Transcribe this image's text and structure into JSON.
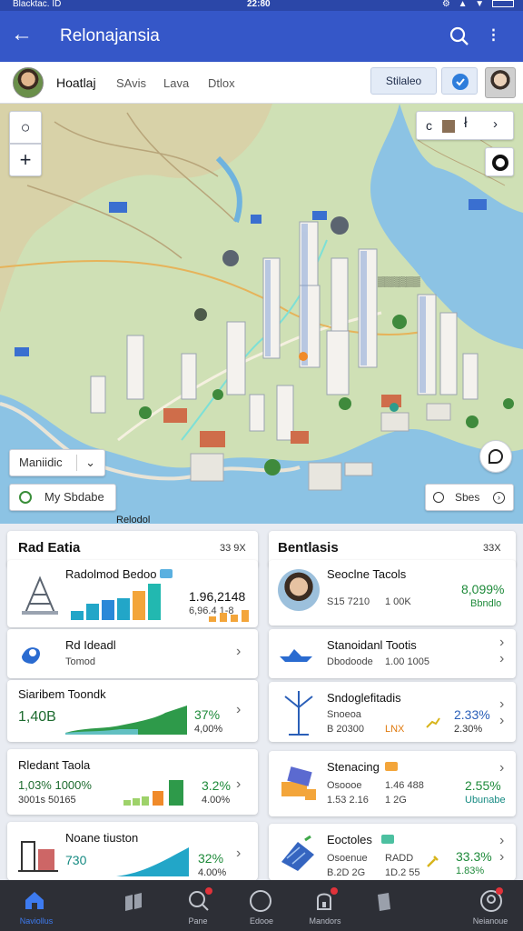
{
  "status_bar": {
    "left": "Blacktac. ID",
    "center": "22:80",
    "right": "⚙ ▲ ▼"
  },
  "app_bar": {
    "title": "Relonajansia",
    "back_icon": "back-arrow-icon",
    "search_icon": "search-icon",
    "more_icon": "more-icon"
  },
  "profile": {
    "name": "Hoatlaj",
    "tabs": [
      "SAvis",
      "Lava",
      "Dtlox"
    ],
    "action_label": "Stilaleo",
    "verify_icon": "verified-badge-icon"
  },
  "map": {
    "zoom_out": "○",
    "zoom_in": "+",
    "layers": {
      "icon_a": "c",
      "icon_c": "ł",
      "icon_d": "›"
    },
    "mode_dropdown": "Maniidic",
    "my_status": "My Sbdabe",
    "slides": "Sbes",
    "bottom_label": "Relodol"
  },
  "left_panel": {
    "title": "Rad Eatia",
    "badge": "33 9X",
    "cards": [
      {
        "title": "Radolmod Bedoo",
        "value": "1.96,2148",
        "sub": "6,96.4 1-8",
        "icon": "crane-icon",
        "bars": [
          0.25,
          0.45,
          0.55,
          0.6,
          0.8,
          1.0,
          0.4,
          0.7
        ]
      },
      {
        "title": "Rd Ideadl",
        "sub": "Tomod",
        "icon": "map-pin-icon"
      },
      {
        "title": "Siaribem Toondk",
        "value": "1,40B",
        "pct": "37%",
        "sub": "4,00%"
      },
      {
        "title": "Rledant Taola",
        "value": "1,03% 1000%",
        "sub": "3001s 50165",
        "pct": "3.2%",
        "sub2": "4.00%"
      },
      {
        "title": "Noane tiuston",
        "value": "730",
        "pct": "32%",
        "sub2": "4.00%",
        "icon": "building-icon"
      }
    ]
  },
  "right_panel": {
    "title": "Bentlasis",
    "badge": "33X",
    "cards": [
      {
        "title": "Seoclne Tacols",
        "sub": "S15 7210",
        "sub2": "1 00K",
        "value": "8,099%",
        "value_sub": "Bbndlo",
        "icon": "person-avatar"
      },
      {
        "title": "Stanoidanl Tootis",
        "sub": "Dbodoode",
        "sub2": "1.00 1005",
        "icon": "ship-icon"
      },
      {
        "title": "Sndoglefitadis",
        "sub": "Snoeoa",
        "sub2": "B 20300",
        "sub3": "LNX",
        "value": "2.33%",
        "sub4": "2.30%",
        "icon": "wind-turbine-icon"
      },
      {
        "title": "Stenacing",
        "sub": "Osoooe",
        "sub2": "1.53 2.16",
        "sub3": "1.46 488",
        "sub4": "1 2G",
        "value": "2.55%",
        "value_sub": "Ubunabe",
        "icon": "factory-icon"
      },
      {
        "title": "Eoctoles",
        "sub": "Osoenue",
        "sub2": "B.2D 2G",
        "sub3": "RADD",
        "sub4": "1D.2 55",
        "value": "33.3%",
        "value_sub": "1.83%",
        "icon": "solar-panel-icon"
      }
    ]
  },
  "bottom_nav": [
    {
      "label": "Naviollus",
      "icon": "home-icon",
      "active": true
    },
    {
      "label": "",
      "icon": "flag-icon",
      "active": false
    },
    {
      "label": "Pane",
      "icon": "search-icon",
      "active": false
    },
    {
      "label": "Edooe",
      "icon": "circle-icon",
      "active": false
    },
    {
      "label": "Mandors",
      "icon": "lock-icon",
      "active": false
    },
    {
      "label": "",
      "icon": "bookmark-icon",
      "active": false
    },
    {
      "label": "Neianoue",
      "icon": "profile-icon",
      "active": false
    }
  ],
  "colors": {
    "appbar": "#3557c8",
    "nav_bg": "#2d2f36",
    "accent": "#3d7bf0",
    "positive": "#1e8a3a"
  }
}
